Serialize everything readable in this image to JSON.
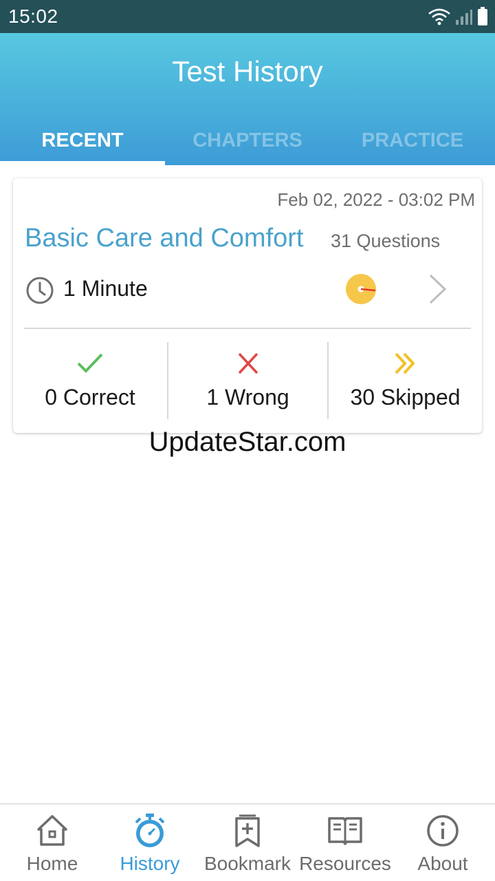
{
  "status_bar": {
    "time": "15:02"
  },
  "header": {
    "title": "Test History",
    "tabs": [
      {
        "label": "RECENT",
        "active": true
      },
      {
        "label": "CHAPTERS",
        "active": false
      },
      {
        "label": "PRACTICE",
        "active": false
      }
    ]
  },
  "history_card": {
    "date": "Feb 02, 2022 - 03:02 PM",
    "title": "Basic Care and Comfort",
    "questions": "31 Questions",
    "duration": "1 Minute",
    "stats": {
      "correct": "0 Correct",
      "wrong": "1 Wrong",
      "skipped": "30 Skipped"
    }
  },
  "watermark": "UpdateStar.com",
  "bottom_nav": [
    {
      "label": "Home",
      "icon": "home-icon",
      "active": false
    },
    {
      "label": "History",
      "icon": "stopwatch-icon",
      "active": true
    },
    {
      "label": "Bookmark",
      "icon": "bookmark-icon",
      "active": false
    },
    {
      "label": "Resources",
      "icon": "book-icon",
      "active": false
    },
    {
      "label": "About",
      "icon": "info-icon",
      "active": false
    }
  ],
  "colors": {
    "status_bar": "#245058",
    "header_top": "#58c8e0",
    "header_bottom": "#3d9bd6",
    "title_blue": "#4aa2cc",
    "correct_green": "#5cbf5c",
    "wrong_red": "#e04848",
    "skipped_yellow": "#f2c02a",
    "nav_active": "#3a9bd8"
  }
}
